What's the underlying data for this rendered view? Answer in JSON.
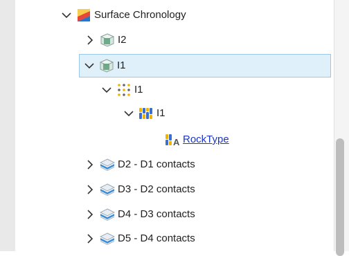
{
  "tree": {
    "root": {
      "label": "Surface Chronology",
      "icon": "surface-chronology-icon"
    },
    "items": [
      {
        "label": "I2",
        "icon": "volume-icon",
        "expanded": false
      },
      {
        "label": "I1",
        "icon": "volume-icon",
        "expanded": true,
        "selected": true
      },
      {
        "label": "I1",
        "icon": "points-icon",
        "expanded": true
      },
      {
        "label": "I1",
        "icon": "bar-columns-icon",
        "expanded": true
      },
      {
        "label": "RockType",
        "icon": "rocktype-icon",
        "link": true
      },
      {
        "label": "D2 - D1 contacts",
        "icon": "contact-surface-icon",
        "expanded": false
      },
      {
        "label": "D3 - D2 contacts",
        "icon": "contact-surface-icon",
        "expanded": false
      },
      {
        "label": "D4 - D3 contacts",
        "icon": "contact-surface-icon",
        "expanded": false
      },
      {
        "label": "D5 - D4 contacts",
        "icon": "contact-surface-icon",
        "expanded": false
      }
    ]
  },
  "colors": {
    "selection_bg": "#dff0fb",
    "selection_border": "#9bc8e8",
    "link": "#1a35c8"
  }
}
